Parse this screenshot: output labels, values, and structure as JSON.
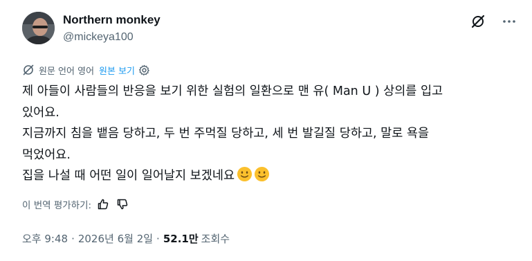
{
  "author": {
    "display_name": "Northern monkey",
    "handle": "@mickeya100"
  },
  "icons": {
    "avatar": "avatar",
    "grok": "slashed-circle-icon",
    "more": "more-icon",
    "translate": "translate-icon",
    "settings": "gear-icon",
    "thumbs_up": "thumbs-up-icon",
    "thumbs_down": "thumbs-down-icon",
    "emoji": "slightly-smiling-face-emoji"
  },
  "translation": {
    "label": "원문 언어 영어",
    "show_original": "원본 보기"
  },
  "post": {
    "lines": [
      "제 아들이 사람들의 반응을 보기 위한 실험의 일환으로 맨 유( Man U ) 상의를 입고",
      "있어요.",
      "지금까지 침을 뱉음 당하고, 두 번 주먹질 당하고, 세 번 발길질 당하고, 말로 욕을",
      "먹었어요.",
      "집을 나설 때 어떤 일이 일어날지 보겠네요"
    ],
    "emoji_count": 2
  },
  "rating": {
    "label": "이 번역 평가하기:"
  },
  "meta": {
    "time": "오후 9:48",
    "separator": "·",
    "date": "2026년 6월 2일",
    "views_count": "52.1만",
    "views_label": "조회수"
  },
  "colors": {
    "text_primary": "#0f1419",
    "text_secondary": "#536471",
    "link": "#1d9bf0",
    "emoji_face": "#fbc02d"
  }
}
